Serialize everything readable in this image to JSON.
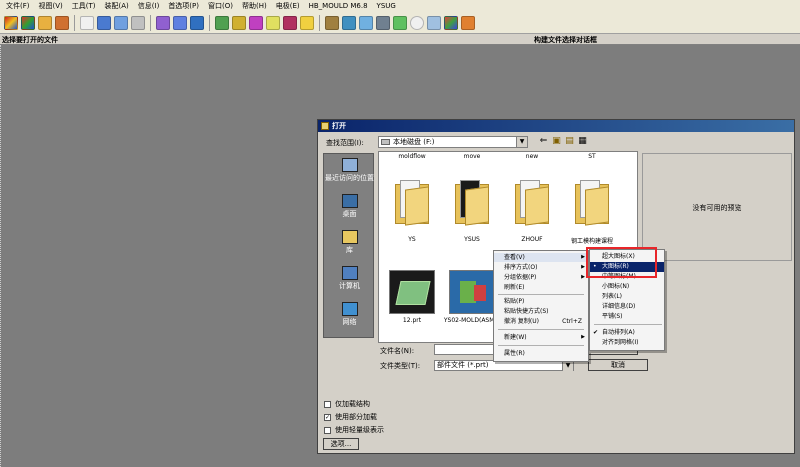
{
  "menubar": [
    "文件(F)",
    "视图(V)",
    "工具(T)",
    "装配(A)",
    "信息(I)",
    "首选项(P)",
    "窗口(O)",
    "帮助(H)",
    "电极(E)",
    "HB_MOULD M6.8",
    "YSUG"
  ],
  "cue": {
    "left": "选择要打开的文件",
    "right": "构建文件选择对话框"
  },
  "dialog": {
    "title": "打开",
    "lookin_label": "查找范围(I):",
    "lookin_value": "本地磁盘 (F:)",
    "places": [
      "最近访问的位置",
      "桌面",
      "库",
      "计算机",
      "网络"
    ],
    "preview_text": "没有可用的预览",
    "filename_label": "文件名(N):",
    "filename_value": "",
    "filetype_label": "文件类型(T):",
    "filetype_value": "部件文件 (*.prt)",
    "cancel_label": "取消",
    "options_label": "选项...",
    "checkboxes": [
      {
        "label": "仅加载结构",
        "checked": false
      },
      {
        "label": "使用部分加载",
        "checked": true
      },
      {
        "label": "使用轻量级表示",
        "checked": false
      }
    ],
    "top_row_labels": [
      "moldflow",
      "move",
      "new",
      "ST"
    ],
    "folders": [
      "YS",
      "YSUS",
      "ZHOUF",
      "钢工模构建课程"
    ],
    "files": [
      "12.prt",
      "YS02-MOLD(ASM..."
    ]
  },
  "context_menu": {
    "items": [
      {
        "label": "查看(V)",
        "arrow": true
      },
      {
        "label": "排序方式(O)",
        "arrow": true
      },
      {
        "label": "分组依据(P)",
        "arrow": true
      },
      {
        "label": "刷新(E)"
      },
      {
        "label": "粘贴(P)"
      },
      {
        "label": "粘贴快捷方式(S)"
      },
      {
        "label": "撤消 复制(U)",
        "shortcut": "Ctrl+Z"
      },
      {
        "label": "新建(W)",
        "arrow": true
      },
      {
        "label": "属性(R)"
      }
    ]
  },
  "view_submenu": {
    "items": [
      {
        "label": "超大图标(X)"
      },
      {
        "label": "大图标(R)",
        "selected": true,
        "mark": "•"
      },
      {
        "label": "中等图标(M)"
      },
      {
        "label": "小图标(N)"
      },
      {
        "label": "列表(L)"
      },
      {
        "label": "详细信息(D)"
      },
      {
        "label": "平铺(S)"
      },
      {
        "label": "自动排列(A)",
        "mark": "✔"
      },
      {
        "label": "对齐到网格(I)"
      }
    ]
  },
  "colors": {
    "highlight_box": "#e8262a",
    "selection": "#0a246a",
    "title_bar": "#0a246a"
  }
}
